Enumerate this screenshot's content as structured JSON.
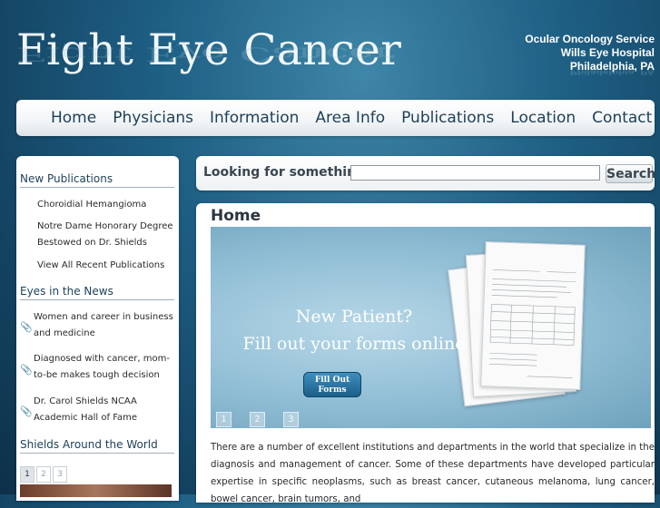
{
  "header": {
    "logo": "Fight Eye Cancer",
    "service_lines": [
      "Ocular Oncology Service",
      "Wills Eye Hospital",
      "Philadelphia, PA"
    ]
  },
  "nav": {
    "items": [
      "Home",
      "Physicians",
      "Information",
      "Area Info",
      "Publications",
      "Location",
      "Contact"
    ]
  },
  "sidebar": {
    "new_publications": {
      "heading": "New Publications",
      "items": [
        "Choroidial Hemangioma",
        "Notre Dame Honorary Degree Bestowed on Dr. Shields",
        "View All Recent Publications"
      ]
    },
    "eyes_in_news": {
      "heading": "Eyes in the News",
      "items": [
        "Women and career in business and medicine",
        "Diagnosed with cancer, mom-to-be makes tough decision",
        "Dr. Carol Shields NCAA Academic Hall of Fame"
      ]
    },
    "shields_world": {
      "heading": "Shields Around the World",
      "pages": [
        "1",
        "2",
        "3"
      ]
    }
  },
  "search": {
    "label": "Looking for something?",
    "value": "",
    "button": "Search"
  },
  "main": {
    "title": "Home",
    "banner": {
      "headline": "New Patient?",
      "subline": "Fill out your forms online",
      "button": "Fill Out Forms",
      "pages": [
        "1",
        "2",
        "3"
      ]
    },
    "body": "There are a number of excellent institutions and departments in the world that specialize in the diagnosis and management of cancer. Some of these departments have developed particular expertise in specific neoplasms, such as breast cancer, cutaneous melanoma, lung cancer, bowel cancer, brain tumors, and"
  },
  "colors": {
    "nav_text": "#1d3f57",
    "background": "#1e5f84",
    "banner": "#8fbdd4"
  }
}
